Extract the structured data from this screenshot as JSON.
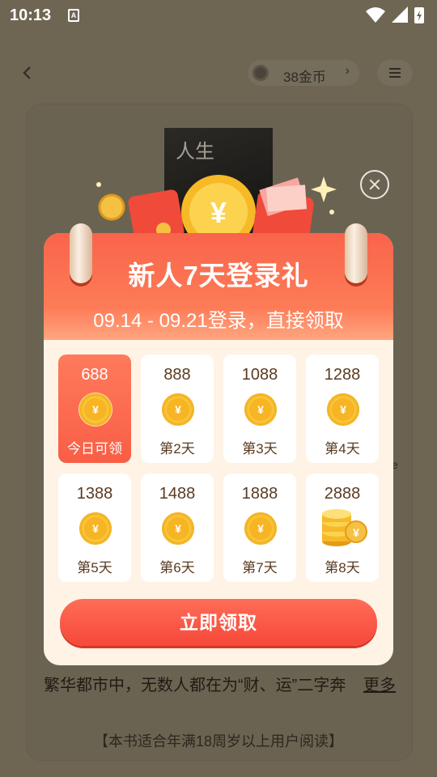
{
  "status_bar": {
    "time": "10:13",
    "a_badge": "A"
  },
  "topbar": {
    "coins_label": "38金币",
    "coins_chevron": "›"
  },
  "book": {
    "cover_text": "人生",
    "synopsis": "繁华都市中，无数人都在为“财、运”二字奔",
    "more_link": "更多",
    "notice": "【本书适合年满18周岁以上用户阅读】",
    "stray_char": "e"
  },
  "popup": {
    "title": "新人7天登录礼",
    "subtitle": "09.14 - 09.21登录，直接领取",
    "coin_symbol": "¥",
    "days": [
      {
        "amount": "688",
        "label": "今日可领",
        "active": true
      },
      {
        "amount": "888",
        "label": "第2天"
      },
      {
        "amount": "1088",
        "label": "第3天"
      },
      {
        "amount": "1288",
        "label": "第4天"
      },
      {
        "amount": "1388",
        "label": "第5天"
      },
      {
        "amount": "1488",
        "label": "第6天"
      },
      {
        "amount": "1888",
        "label": "第7天"
      },
      {
        "amount": "2888",
        "label": "第8天",
        "stack": true
      }
    ],
    "claim_button": "立即领取"
  },
  "colors": {
    "accent": "#f95e45",
    "coin": "#f8c437",
    "popup_bg": "#fff3e6",
    "overlay": "#6e6553"
  }
}
